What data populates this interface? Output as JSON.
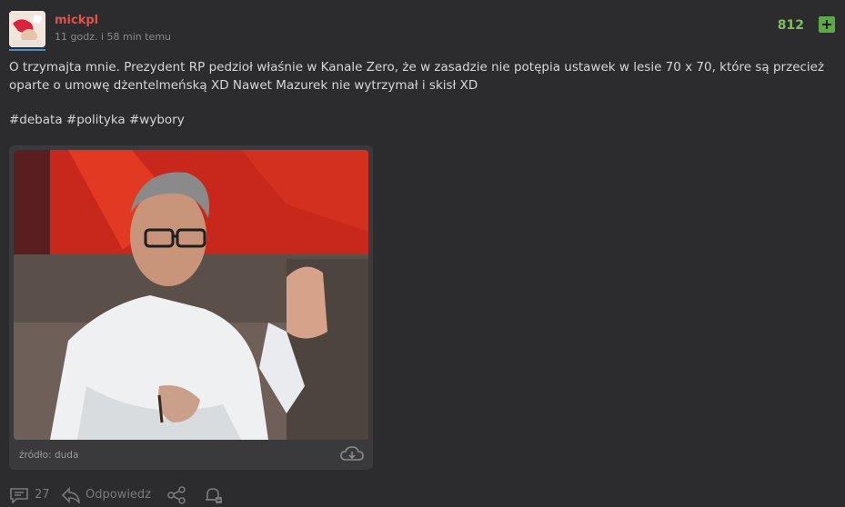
{
  "post": {
    "username": "mickpl",
    "time": "11 godz. i 58 min temu",
    "score": "812",
    "body": "O trzymajta mnie. Prezydent RP pedzioł właśnie w Kanale Zero, że w zasadzie nie potępia ustawek w lesie 70 x 70, które są przecież oparte o umowę dżentelmeńską XD Nawet Mazurek nie wytrzymał i skisł XD",
    "tags": [
      "#debata",
      "#polityka",
      "#wybory"
    ],
    "media": {
      "source": "źródło: duda"
    }
  },
  "actions": {
    "comments_count": "27",
    "reply_label": "Odpowiedz"
  },
  "icons": [
    "comment-icon",
    "reply-icon",
    "share-icon",
    "notification-bell-icon",
    "download-cloud-icon",
    "plus-icon"
  ],
  "colors": {
    "background": "#2c2c2e",
    "username": "#e0524e",
    "score": "#7fbf5f",
    "plus_button": "#5fa84a",
    "avatar_underline": "#4a90c8"
  }
}
